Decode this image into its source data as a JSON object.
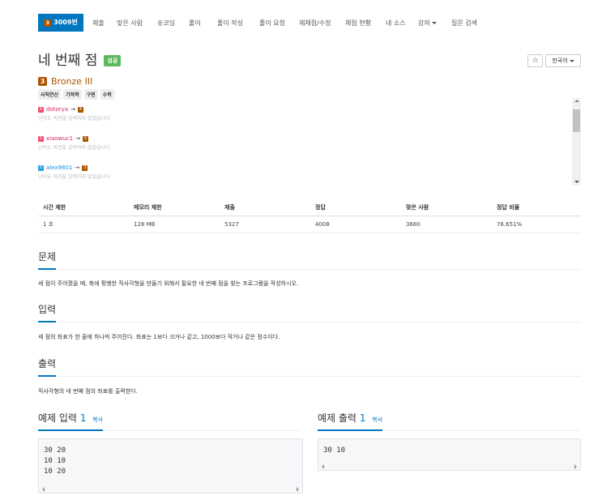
{
  "nav": {
    "active": {
      "badge": "3",
      "label": "3009번"
    },
    "items": [
      "제출",
      "맞은 사람",
      "숏코딩",
      "풀이",
      "풀이 작성",
      "풀이 요청",
      "재채점/수정",
      "채점 현황",
      "내 소스",
      "강의",
      "질문 검색"
    ]
  },
  "problem": {
    "title": "네 번째 점",
    "status": "성공",
    "tier": "Bronze III",
    "tier_num": "3",
    "tags": [
      "사칙연산",
      "기하학",
      "구현",
      "수학"
    ],
    "star": "☆",
    "language": "한국어"
  },
  "opinions": [
    {
      "user": "dotorya",
      "from": "4",
      "to": "4",
      "note": "난이도 의견을 입력하지 않았습니다"
    },
    {
      "user": "xiaowuc1",
      "from": "5",
      "to": "5",
      "note": "난이도 의견을 입력하지 않았습니다"
    },
    {
      "user": "alex9801",
      "from": "5",
      "to": "3",
      "note": "난이도 의견을 입력하지 않았습니다"
    }
  ],
  "arrow": "→",
  "stats": {
    "headers": [
      "시간 제한",
      "메모리 제한",
      "제출",
      "정답",
      "맞은 사람",
      "정답 비율"
    ],
    "values": [
      "1 초",
      "128 MB",
      "5327",
      "4008",
      "3680",
      "76.651%"
    ]
  },
  "sections": {
    "problem_title": "문제",
    "problem_text": "세 점이 주어졌을 때, 축에 평행한 직사각형을 만들기 위해서 필요한 네 번째 점을 찾는 프로그램을 작성하시오.",
    "input_title": "입력",
    "input_text": "세 점의 좌표가 한 줄에 하나씩 주어진다. 좌표는 1보다 크거나 같고, 1000보다 작거나 같은 정수이다.",
    "output_title": "출력",
    "output_text": "직사각형의 네 번째 점의 좌표를 출력한다."
  },
  "samples": {
    "input_label": "예제 입력",
    "output_label": "예제 출력",
    "num": "1",
    "copy": "복사",
    "input_code": "30 20\n10 10\n10 20",
    "output_code": "30 10"
  }
}
